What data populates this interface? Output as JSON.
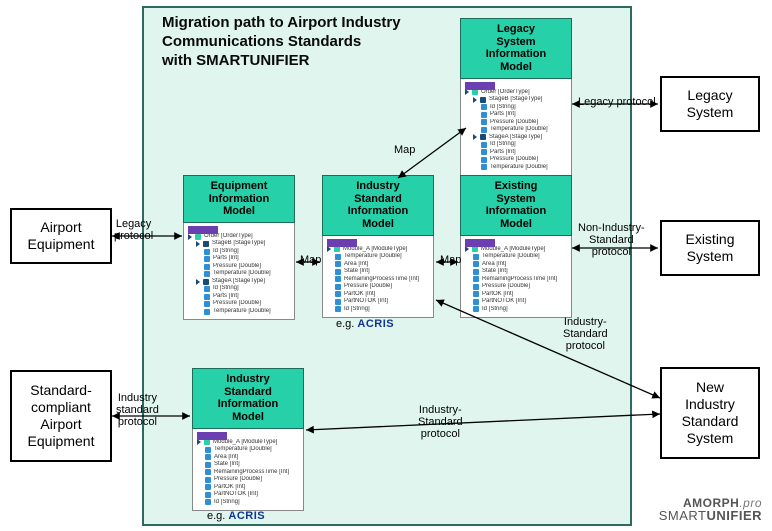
{
  "title": "Migration path to Airport Industry\nCommunications Standards\nwith SMARTUNIFIER",
  "externals": {
    "legacy": "Legacy\nSystem",
    "existing": "Existing\nSystem",
    "new": "New\nIndustry\nStandard\nSystem",
    "airport_equipment": "Airport\nEquipment",
    "compliant_equipment": "Standard-\ncompliant\nAirport\nEquipment"
  },
  "models": {
    "legacy": "Legacy\nSystem\nInformation\nModel",
    "equipment": "Equipment\nInformation\nModel",
    "industry_center": "Industry\nStandard\nInformation\nModel",
    "existing": "Existing\nSystem\nInformation\nModel",
    "industry_bottom": "Industry\nStandard\nInformation\nModel"
  },
  "tree_order": {
    "root": "Order [OrderType]",
    "stageB": "StageB [StageType]",
    "stageA": "StageA [StageType]",
    "items": [
      "Id [String]",
      "Parts [Int]",
      "Pressure [Double]",
      "Temperature [Double]"
    ]
  },
  "tree_module": {
    "root": "Module_A [ModuleType]",
    "items": [
      "Temperature [Double]",
      "Area [Int]",
      "State [Int]",
      "RemainingProcessTime [Int]",
      "Pressure [Double]",
      "PartOK [Int]",
      "PartNOTOK [Int]",
      "Id [String]"
    ]
  },
  "edges": {
    "legacy_protocol": "Legacy protocol",
    "legacy_short": "Legacy\nprotocol",
    "map": "Map",
    "non_industry": "Non-Industry-\nStandard\nprotocol",
    "industry": "Industry-\nStandard\nprotocol",
    "industry_std": "Industry\nstandard\nprotocol"
  },
  "eg": "e.g.",
  "acris": "ACRIS",
  "brand": {
    "top_a": "AMORPH",
    "top_b": ".pro",
    "bot_a": "SMART",
    "bot_b": "UNIFIER"
  }
}
